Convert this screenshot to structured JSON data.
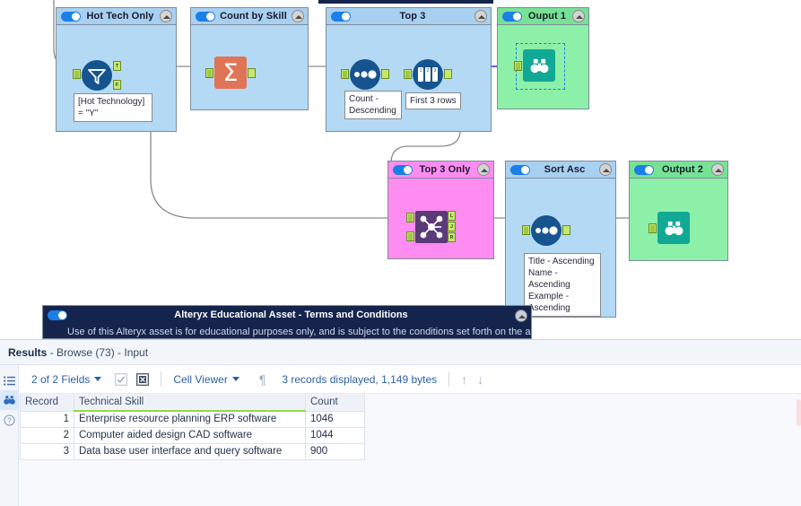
{
  "canvas": {
    "containers": [
      {
        "id": "hot-tech-only",
        "title": "Hot Tech Only",
        "color": "blue",
        "toggle_on": true,
        "annotation": "[Hot Technology]\n= \"Y\"",
        "tool": "filter-tool",
        "ports": [
          "T",
          "F"
        ]
      },
      {
        "id": "count-by-skill",
        "title": "Count by Skill",
        "color": "blue",
        "toggle_on": true,
        "annotation": "",
        "tool": "summarize-tool"
      },
      {
        "id": "top-3",
        "title": "Top 3",
        "color": "blue",
        "toggle_on": true,
        "annotation1": "Count -\nDescending",
        "annotation2": "First 3 rows",
        "tool1": "sort-tool",
        "tool2": "sample-tool"
      },
      {
        "id": "ouput-1",
        "title": "Ouput 1",
        "color": "green",
        "toggle_on": true,
        "tool": "browse-tool"
      },
      {
        "id": "top-3-only",
        "title": "Top 3 Only",
        "color": "pink",
        "toggle_on": true,
        "tool": "join-tool",
        "inputs": [
          "L",
          "R"
        ],
        "outputs": [
          "L",
          "J",
          "R"
        ]
      },
      {
        "id": "sort-asc",
        "title": "Sort Asc",
        "color": "blue",
        "toggle_on": true,
        "annotation": "Title - Ascending\nName -\nAscending\nExample -\nAscending",
        "tool": "sort-tool"
      },
      {
        "id": "output-2",
        "title": "Output 2",
        "color": "green",
        "toggle_on": true,
        "tool": "browse-tool"
      }
    ]
  },
  "terms": {
    "title": "Alteryx Educational Asset - Terms and Conditions",
    "body_text": "Use of this Alteryx asset is for educational purposes only, and is subject to the conditions set forth on the alteryx.com terms and conditions",
    "toggle_on": true
  },
  "results": {
    "title_bold": "Results",
    "title_rest": " - Browse (73) - Input",
    "rail": [
      {
        "name": "list-view-icon",
        "active": false
      },
      {
        "name": "browse-icon",
        "active": true
      },
      {
        "name": "help-icon",
        "active": false
      }
    ],
    "toolbar": {
      "fields_label": "2 of 2 Fields",
      "select_all_icon": "checkbox-checked-icon",
      "deselect_all_icon": "checkbox-x-icon",
      "viewer_label": "Cell Viewer",
      "pilcrow": "¶",
      "record_status": "3 records displayed, 1,149 bytes",
      "up_arrow": "↑",
      "down_arrow": "↓"
    },
    "table": {
      "columns": [
        "Record",
        "Technical Skill",
        "Count"
      ],
      "rows": [
        {
          "record": "1",
          "skill": "Enterprise resource planning ERP software",
          "count": "1046"
        },
        {
          "record": "2",
          "skill": "Computer aided design CAD software",
          "count": "1044"
        },
        {
          "record": "3",
          "skill": "Data base user interface and query software",
          "count": "900"
        }
      ]
    }
  },
  "colors": {
    "container_blue_head": "#a8d0f0",
    "container_blue_body": "#b3d9f5",
    "container_green": "#8cf0a8",
    "container_pink": "#ff8cf0",
    "tool_navy": "#16548f",
    "summarize_orange": "#e07456",
    "join_purple": "#5b3a78",
    "browse_teal": "#11a896",
    "terms_navy": "#14244d",
    "accent_blue": "#2d5fa3",
    "header_underline_green": "#8fd94a",
    "port_green": "#c5e86c",
    "wire_blue": "#2b2bd6",
    "wire_gray": "#8a8a8a",
    "toggle_blue": "#1a7fe8"
  }
}
